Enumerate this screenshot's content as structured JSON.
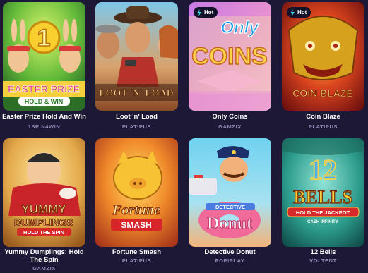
{
  "games": [
    {
      "title": "Easter Prize Hold And Win",
      "provider": "1SPIN4WIN",
      "hot": false,
      "art_text": [
        "1",
        "EASTER PRIZE",
        "HOLD & WIN"
      ]
    },
    {
      "title": "Loot 'n' Load",
      "provider": "PLATIPUS",
      "hot": false,
      "art_text": [
        "LOOT 'N' LOAD"
      ]
    },
    {
      "title": "Only Coins",
      "provider": "GAMZIX",
      "hot": true,
      "art_text": [
        "Only",
        "COINS"
      ]
    },
    {
      "title": "Coin Blaze",
      "provider": "PLATIPUS",
      "hot": true,
      "art_text": [
        "COIN BLAZE"
      ]
    },
    {
      "title": "Yummy Dumplings: Hold The Spin",
      "provider": "GAMZIX",
      "hot": false,
      "art_text": [
        "YUMMY",
        "DUMPLINGS",
        "HOLD THE SPIN"
      ]
    },
    {
      "title": "Fortune Smash",
      "provider": "PLATIPUS",
      "hot": false,
      "art_text": [
        "Fortune",
        "SMASH"
      ]
    },
    {
      "title": "Detective Donut",
      "provider": "POPIPLAY",
      "hot": false,
      "art_text": [
        "DETECTIVE",
        "Donut"
      ]
    },
    {
      "title": "12 Bells",
      "provider": "VOLTENT",
      "hot": false,
      "art_text": [
        "12",
        "BELLS",
        "HOLD THE JACKPOT",
        "CASH INFINITY"
      ]
    }
  ],
  "hot_label": "Hot",
  "colors": {
    "background": "#1c1836",
    "provider_text": "#8f8bb6",
    "hot_badge": "#14112a"
  },
  "icons": {
    "hot": "lightning-icon"
  }
}
